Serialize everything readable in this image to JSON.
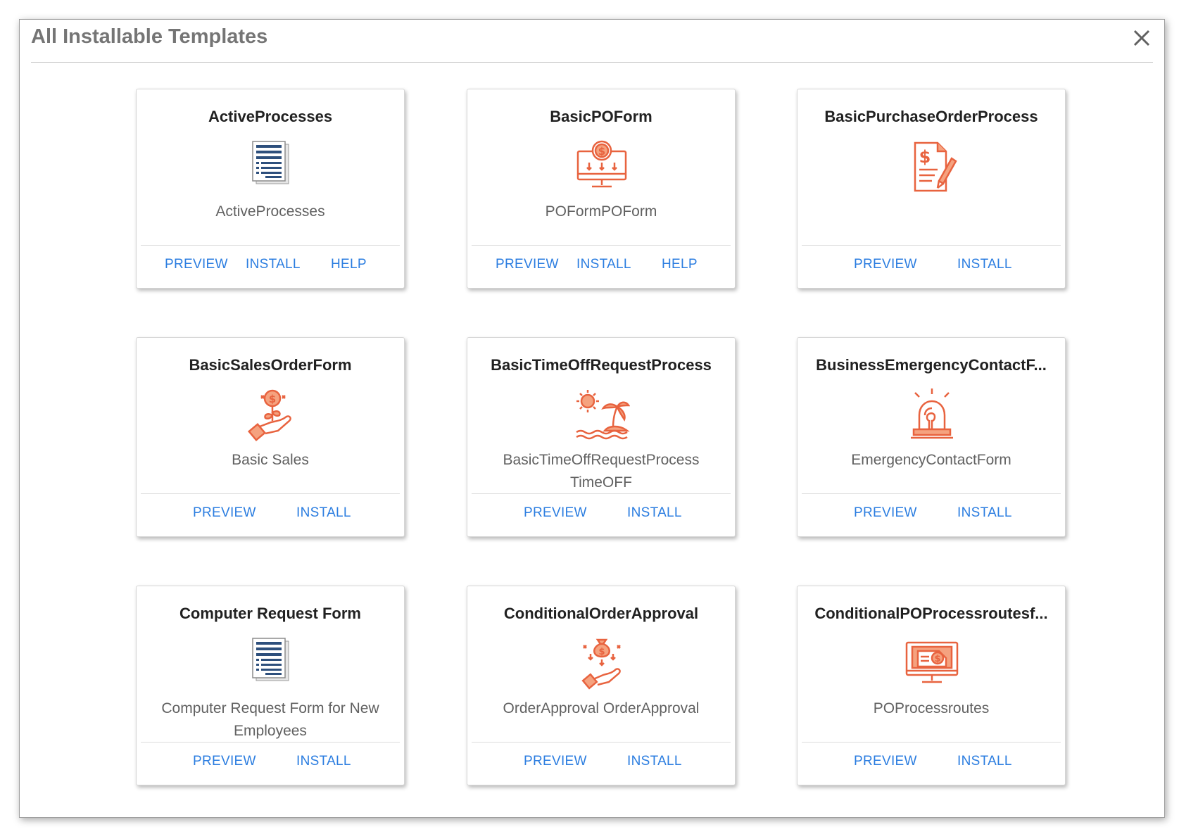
{
  "dialog": {
    "title": "All Installable Templates",
    "close_icon": "close-icon"
  },
  "accent_color": "#2b7de0",
  "icon_color": "#e8633f",
  "cards": [
    {
      "title": "ActiveProcesses",
      "description": "ActiveProcesses",
      "icon": "document-list-icon",
      "preview": "PREVIEW",
      "install": "INSTALL",
      "help": "HELP"
    },
    {
      "title": "BasicPOForm",
      "description": "POFormPOForm",
      "icon": "dollar-monitor-icon",
      "preview": "PREVIEW",
      "install": "INSTALL",
      "help": "HELP"
    },
    {
      "title": "BasicPurchaseOrderProcess",
      "description": "",
      "icon": "dollar-document-pen-icon",
      "preview": "PREVIEW",
      "install": "INSTALL"
    },
    {
      "title": "BasicSalesOrderForm",
      "description": "Basic Sales",
      "icon": "hand-money-plant-icon",
      "preview": "PREVIEW",
      "install": "INSTALL"
    },
    {
      "title": "BasicTimeOffRequestProcess",
      "description": "BasicTimeOffRequestProcess TimeOFF",
      "icon": "island-sun-icon",
      "preview": "PREVIEW",
      "install": "INSTALL"
    },
    {
      "title": "BusinessEmergencyContactF...",
      "description": "EmergencyContactForm",
      "icon": "alarm-siren-icon",
      "preview": "PREVIEW",
      "install": "INSTALL"
    },
    {
      "title": "Computer Request Form",
      "description": "Computer Request Form for New Employees",
      "icon": "document-list-icon",
      "preview": "PREVIEW",
      "install": "INSTALL"
    },
    {
      "title": "ConditionalOrderApproval",
      "description": "OrderApproval OrderApproval",
      "icon": "hand-money-bag-icon",
      "preview": "PREVIEW",
      "install": "INSTALL"
    },
    {
      "title": "ConditionalPOProcessroutesf...",
      "description": "POProcessroutes",
      "icon": "dollar-invoice-monitor-icon",
      "preview": "PREVIEW",
      "install": "INSTALL"
    }
  ]
}
